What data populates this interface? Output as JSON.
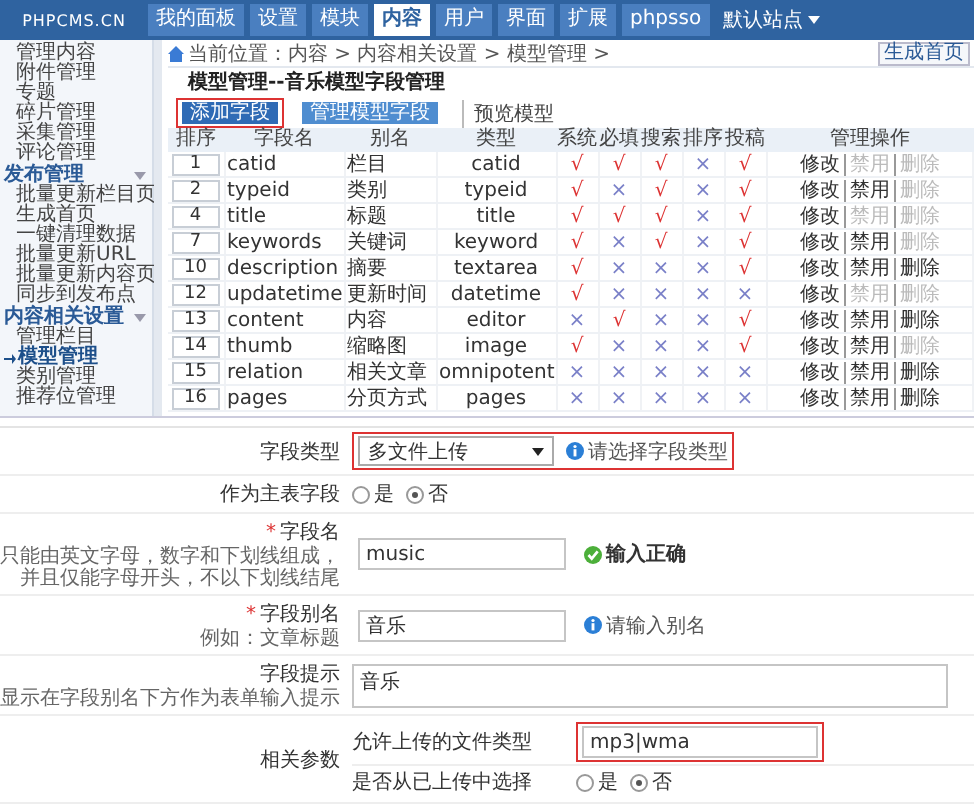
{
  "header": {
    "logo": "PHPCMS.CN",
    "nav": [
      {
        "label": "我的面板",
        "selected": false
      },
      {
        "label": "设置",
        "selected": false
      },
      {
        "label": "模块",
        "selected": false
      },
      {
        "label": "内容",
        "selected": true
      },
      {
        "label": "用户",
        "selected": false
      },
      {
        "label": "界面",
        "selected": false
      },
      {
        "label": "扩展",
        "selected": false
      },
      {
        "label": "phpsso",
        "selected": false
      }
    ],
    "site_menu": "默认站点"
  },
  "sidebar": {
    "sections": [
      {
        "items": [
          {
            "label": "管理内容",
            "selected": false
          },
          {
            "label": "附件管理",
            "selected": false
          },
          {
            "label": "专题",
            "selected": false
          },
          {
            "label": "碎片管理",
            "selected": false
          },
          {
            "label": "采集管理",
            "selected": false
          },
          {
            "label": "评论管理",
            "selected": false
          }
        ]
      },
      {
        "title": "发布管理",
        "items": [
          {
            "label": "批量更新栏目页",
            "selected": false
          },
          {
            "label": "生成首页",
            "selected": false
          },
          {
            "label": "一键清理数据",
            "selected": false
          },
          {
            "label": "批量更新URL",
            "selected": false
          },
          {
            "label": "批量更新内容页",
            "selected": false
          },
          {
            "label": "同步到发布点",
            "selected": false
          }
        ]
      },
      {
        "title": "内容相关设置",
        "items": [
          {
            "label": "管理栏目",
            "selected": false
          },
          {
            "label": "模型管理",
            "selected": true
          },
          {
            "label": "类别管理",
            "selected": false
          },
          {
            "label": "推荐位管理",
            "selected": false
          }
        ]
      }
    ]
  },
  "breadcrumb": "当前位置：内容 > 内容相关设置 > 模型管理 >",
  "generate_button": "生成首页",
  "page_title": "模型管理--音乐模型字段管理",
  "toolbar": [
    {
      "kind": "button",
      "label": "添加字段",
      "selected": true,
      "highlighted": true
    },
    {
      "kind": "button",
      "label": "管理模型字段",
      "selected": false,
      "highlighted": false
    },
    {
      "kind": "link",
      "label": "预览模型",
      "selected": false,
      "highlighted": false
    }
  ],
  "table": {
    "columns": [
      "排序",
      "字段名",
      "别名",
      "类型",
      "系统",
      "必填",
      "搜索",
      "排序",
      "投稿",
      "管理操作"
    ],
    "rows": [
      {
        "order": "1",
        "field": "catid",
        "alias": "栏目",
        "type": "catid",
        "flags": [
          {
            "mark": "√",
            "on": true
          },
          {
            "mark": "√",
            "on": true
          },
          {
            "mark": "√",
            "on": true
          },
          {
            "mark": "×",
            "on": false
          },
          {
            "mark": "√",
            "on": true
          }
        ],
        "actions": [
          {
            "label": "修改",
            "disabled": false
          },
          {
            "label": "禁用",
            "disabled": true
          },
          {
            "label": "删除",
            "disabled": true
          }
        ]
      },
      {
        "order": "2",
        "field": "typeid",
        "alias": "类别",
        "type": "typeid",
        "flags": [
          {
            "mark": "√",
            "on": true
          },
          {
            "mark": "×",
            "on": false
          },
          {
            "mark": "√",
            "on": true
          },
          {
            "mark": "×",
            "on": false
          },
          {
            "mark": "√",
            "on": true
          }
        ],
        "actions": [
          {
            "label": "修改",
            "disabled": false
          },
          {
            "label": "禁用",
            "disabled": false
          },
          {
            "label": "删除",
            "disabled": true
          }
        ]
      },
      {
        "order": "4",
        "field": "title",
        "alias": "标题",
        "type": "title",
        "flags": [
          {
            "mark": "√",
            "on": true
          },
          {
            "mark": "√",
            "on": true
          },
          {
            "mark": "√",
            "on": true
          },
          {
            "mark": "×",
            "on": false
          },
          {
            "mark": "√",
            "on": true
          }
        ],
        "actions": [
          {
            "label": "修改",
            "disabled": false
          },
          {
            "label": "禁用",
            "disabled": true
          },
          {
            "label": "删除",
            "disabled": true
          }
        ]
      },
      {
        "order": "7",
        "field": "keywords",
        "alias": "关键词",
        "type": "keyword",
        "flags": [
          {
            "mark": "√",
            "on": true
          },
          {
            "mark": "×",
            "on": false
          },
          {
            "mark": "√",
            "on": true
          },
          {
            "mark": "×",
            "on": false
          },
          {
            "mark": "√",
            "on": true
          }
        ],
        "actions": [
          {
            "label": "修改",
            "disabled": false
          },
          {
            "label": "禁用",
            "disabled": false
          },
          {
            "label": "删除",
            "disabled": true
          }
        ]
      },
      {
        "order": "10",
        "field": "description",
        "alias": "摘要",
        "type": "textarea",
        "flags": [
          {
            "mark": "√",
            "on": true
          },
          {
            "mark": "×",
            "on": false
          },
          {
            "mark": "×",
            "on": false
          },
          {
            "mark": "×",
            "on": false
          },
          {
            "mark": "√",
            "on": true
          }
        ],
        "actions": [
          {
            "label": "修改",
            "disabled": false
          },
          {
            "label": "禁用",
            "disabled": false
          },
          {
            "label": "删除",
            "disabled": false
          }
        ]
      },
      {
        "order": "12",
        "field": "updatetime",
        "alias": "更新时间",
        "type": "datetime",
        "flags": [
          {
            "mark": "√",
            "on": true
          },
          {
            "mark": "×",
            "on": false
          },
          {
            "mark": "×",
            "on": false
          },
          {
            "mark": "×",
            "on": false
          },
          {
            "mark": "×",
            "on": false
          }
        ],
        "actions": [
          {
            "label": "修改",
            "disabled": false
          },
          {
            "label": "禁用",
            "disabled": true
          },
          {
            "label": "删除",
            "disabled": true
          }
        ]
      },
      {
        "order": "13",
        "field": "content",
        "alias": "内容",
        "type": "editor",
        "flags": [
          {
            "mark": "×",
            "on": false
          },
          {
            "mark": "√",
            "on": true
          },
          {
            "mark": "×",
            "on": false
          },
          {
            "mark": "×",
            "on": false
          },
          {
            "mark": "√",
            "on": true
          }
        ],
        "actions": [
          {
            "label": "修改",
            "disabled": false
          },
          {
            "label": "禁用",
            "disabled": false
          },
          {
            "label": "删除",
            "disabled": false
          }
        ]
      },
      {
        "order": "14",
        "field": "thumb",
        "alias": "缩略图",
        "type": "image",
        "flags": [
          {
            "mark": "√",
            "on": true
          },
          {
            "mark": "×",
            "on": false
          },
          {
            "mark": "×",
            "on": false
          },
          {
            "mark": "×",
            "on": false
          },
          {
            "mark": "√",
            "on": true
          }
        ],
        "actions": [
          {
            "label": "修改",
            "disabled": false
          },
          {
            "label": "禁用",
            "disabled": false
          },
          {
            "label": "删除",
            "disabled": true
          }
        ]
      },
      {
        "order": "15",
        "field": "relation",
        "alias": "相关文章",
        "type": "omnipotent",
        "flags": [
          {
            "mark": "×",
            "on": false
          },
          {
            "mark": "×",
            "on": false
          },
          {
            "mark": "×",
            "on": false
          },
          {
            "mark": "×",
            "on": false
          },
          {
            "mark": "×",
            "on": false
          }
        ],
        "actions": [
          {
            "label": "修改",
            "disabled": false
          },
          {
            "label": "禁用",
            "disabled": false
          },
          {
            "label": "删除",
            "disabled": false
          }
        ]
      },
      {
        "order": "16",
        "field": "pages",
        "alias": "分页方式",
        "type": "pages",
        "flags": [
          {
            "mark": "×",
            "on": false
          },
          {
            "mark": "×",
            "on": false
          },
          {
            "mark": "×",
            "on": false
          },
          {
            "mark": "×",
            "on": false
          },
          {
            "mark": "×",
            "on": false
          }
        ],
        "actions": [
          {
            "label": "修改",
            "disabled": false
          },
          {
            "label": "禁用",
            "disabled": false
          },
          {
            "label": "删除",
            "disabled": false
          }
        ]
      }
    ]
  },
  "form": {
    "rows": [
      {
        "kind": "select",
        "label": "字段类型",
        "value": "多文件上传",
        "tip": {
          "kind": "info",
          "text": "请选择字段类型"
        },
        "highlighted": true
      },
      {
        "kind": "radio",
        "label": "作为主表字段",
        "options": [
          {
            "label": "是",
            "selected": false
          },
          {
            "label": "否",
            "selected": true
          }
        ]
      },
      {
        "kind": "input",
        "label": "字段名",
        "mark": "*",
        "hint": "只能由英文字母，数字和下划线组成，并且仅能字母开头，不以下划线结尾",
        "value": "music",
        "tip": {
          "kind": "ok",
          "text": "输入正确"
        }
      },
      {
        "kind": "input",
        "label": "字段别名",
        "mark": "*",
        "hint": "例如：文章标题",
        "value": "音乐",
        "tip": {
          "kind": "info",
          "text": "请输入别名"
        }
      },
      {
        "kind": "textarea",
        "label": "字段提示",
        "hint": "显示在字段别名下方作为表单输入提示",
        "value": "音乐"
      },
      {
        "kind": "params",
        "label": "相关参数",
        "rows": [
          {
            "kind": "input",
            "label": "允许上传的文件类型",
            "value": "mp3|wma",
            "highlighted": true
          },
          {
            "kind": "radio",
            "label": "是否从已上传中选择",
            "options": [
              {
                "label": "是",
                "selected": false
              },
              {
                "label": "否",
                "selected": true
              }
            ]
          }
        ]
      }
    ]
  }
}
